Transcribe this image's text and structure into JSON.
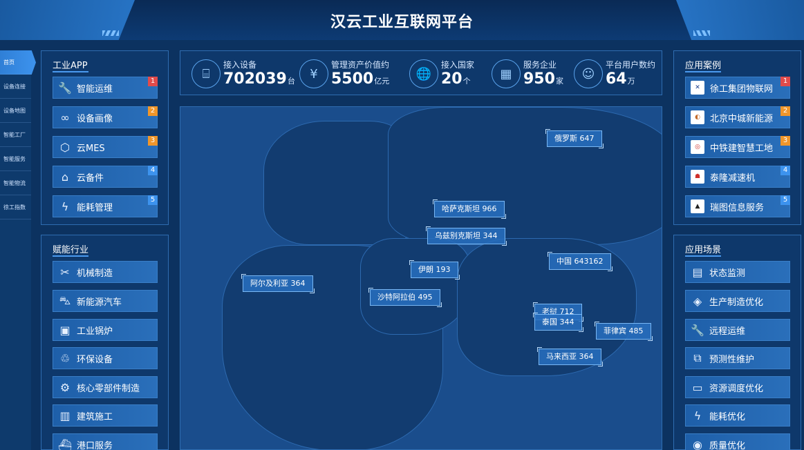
{
  "header": {
    "title": "汉云工业互联网平台"
  },
  "nav": {
    "items": [
      {
        "label": "首页",
        "active": true
      },
      {
        "label": "设备连接"
      },
      {
        "label": "设备地图"
      },
      {
        "label": "智能工厂"
      },
      {
        "label": "智能服务"
      },
      {
        "label": "智能物流"
      },
      {
        "label": "徐工指数"
      }
    ]
  },
  "industrial_app": {
    "title": "工业APP",
    "items": [
      {
        "label": "智能运维",
        "badge": "1",
        "icon": "wrench-icon"
      },
      {
        "label": "设备画像",
        "badge": "2",
        "icon": "link-icon"
      },
      {
        "label": "云MES",
        "badge": "3",
        "icon": "hexagon-gear-icon"
      },
      {
        "label": "云备件",
        "badge": "4",
        "icon": "house-box-icon"
      },
      {
        "label": "能耗管理",
        "badge": "5",
        "icon": "lightning-icon"
      }
    ]
  },
  "industries": {
    "title": "赋能行业",
    "items": [
      {
        "label": "机械制造",
        "icon": "tools-icon"
      },
      {
        "label": "新能源汽车",
        "icon": "car-icon"
      },
      {
        "label": "工业锅炉",
        "icon": "boiler-icon"
      },
      {
        "label": "环保设备",
        "icon": "recycle-icon"
      },
      {
        "label": "核心零部件制造",
        "icon": "gear-icon"
      },
      {
        "label": "建筑施工",
        "icon": "building-icon"
      },
      {
        "label": "港口服务",
        "icon": "ship-icon"
      }
    ]
  },
  "stats": [
    {
      "label": "接入设备",
      "value": "702039",
      "unit": "台",
      "icon": "router-icon"
    },
    {
      "label": "管理资产价值约",
      "value": "5500",
      "unit": "亿元",
      "icon": "yen-icon"
    },
    {
      "label": "接入国家",
      "value": "20",
      "unit": "个",
      "icon": "globe-icon"
    },
    {
      "label": "服务企业",
      "value": "950",
      "unit": "家",
      "icon": "office-building-icon"
    },
    {
      "label": "平台用户数约",
      "value": "64",
      "unit": "万",
      "icon": "user-icon"
    }
  ],
  "map": {
    "tags": [
      {
        "label": "俄罗斯 647"
      },
      {
        "label": "哈萨克斯坦 966"
      },
      {
        "label": "乌兹别克斯坦 344"
      },
      {
        "label": "伊朗 193"
      },
      {
        "label": "中国 643162"
      },
      {
        "label": "阿尔及利亚 364"
      },
      {
        "label": "沙特阿拉伯 495"
      },
      {
        "label": "老挝 712"
      },
      {
        "label": "泰国 344"
      },
      {
        "label": "菲律宾 485"
      },
      {
        "label": "马来西亚 364"
      }
    ]
  },
  "cases": {
    "title": "应用案例",
    "items": [
      {
        "label": "徐工集团物联网",
        "badge": "1",
        "icon": "xcmg-logo-icon"
      },
      {
        "label": "北京中城新能源",
        "badge": "2",
        "icon": "zhongcheng-logo-icon"
      },
      {
        "label": "中铁建智慧工地",
        "badge": "3",
        "icon": "crcc-logo-icon"
      },
      {
        "label": "泰隆减速机",
        "badge": "4",
        "icon": "tailong-logo-icon"
      },
      {
        "label": "瑞图信息服务",
        "badge": "5",
        "icon": "ruitu-logo-icon"
      }
    ]
  },
  "scenarios": {
    "title": "应用场景",
    "items": [
      {
        "label": "状态监测",
        "icon": "monitor-icon"
      },
      {
        "label": "生产制造优化",
        "icon": "layers-icon"
      },
      {
        "label": "远程运维",
        "icon": "wrench-icon"
      },
      {
        "label": "预测性维护",
        "icon": "chart-icon"
      },
      {
        "label": "资源调度优化",
        "icon": "folder-icon"
      },
      {
        "label": "能耗优化",
        "icon": "lightning-icon"
      },
      {
        "label": "质量优化",
        "icon": "badge-icon"
      }
    ]
  },
  "colors": {
    "badge1": "#e14b4b",
    "badge2": "#f0962a",
    "badge3": "#f0962a",
    "badge4": "#3d93ee",
    "badge5": "#3d93ee"
  }
}
